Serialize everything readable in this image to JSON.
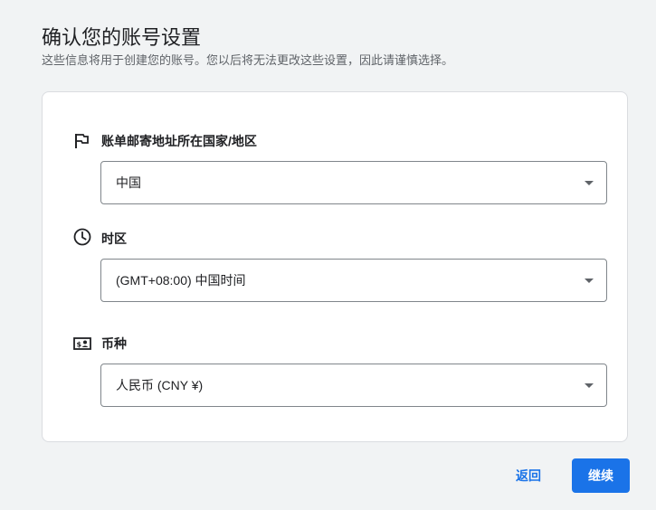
{
  "header": {
    "title": "确认您的账号设置",
    "subtitle": "这些信息将用于创建您的账号。您以后将无法更改这些设置，因此请谨慎选择。"
  },
  "fields": {
    "country": {
      "label": "账单邮寄地址所在国家/地区",
      "value": "中国",
      "icon": "flag-icon"
    },
    "timezone": {
      "label": "时区",
      "value": "(GMT+08:00) 中国时间",
      "icon": "clock-icon"
    },
    "currency": {
      "label": "币种",
      "value": "人民币 (CNY ¥)",
      "icon": "currency-icon"
    }
  },
  "actions": {
    "back_label": "返回",
    "continue_label": "继续"
  },
  "colors": {
    "accent": "#1a73e8",
    "background": "#f1f3f4",
    "card": "#ffffff",
    "border": "#dadce0",
    "text_secondary": "#5f6368"
  }
}
